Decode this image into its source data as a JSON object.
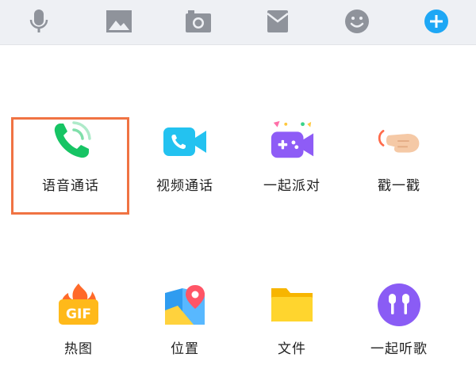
{
  "toolbar": {
    "icons": [
      "microphone-icon",
      "image-icon",
      "camera-icon",
      "red-packet-icon",
      "emoji-icon",
      "plus-icon"
    ],
    "colors": {
      "icon": "#8f939b",
      "plus": "#1ea7f5",
      "bar": "#eef0f4"
    }
  },
  "panel": {
    "row1": [
      {
        "label": "语音通话",
        "icon": "phone-call-icon"
      },
      {
        "label": "视频通话",
        "icon": "video-call-icon"
      },
      {
        "label": "一起派对",
        "icon": "party-game-icon"
      },
      {
        "label": "戳一戳",
        "icon": "poke-hand-icon"
      }
    ],
    "row2": [
      {
        "label": "热图",
        "icon": "hot-gif-icon"
      },
      {
        "label": "位置",
        "icon": "location-map-icon"
      },
      {
        "label": "文件",
        "icon": "folder-icon"
      },
      {
        "label": "一起听歌",
        "icon": "earphones-icon"
      }
    ]
  },
  "highlight": {
    "color": "#f07343",
    "target": "语音通话"
  }
}
